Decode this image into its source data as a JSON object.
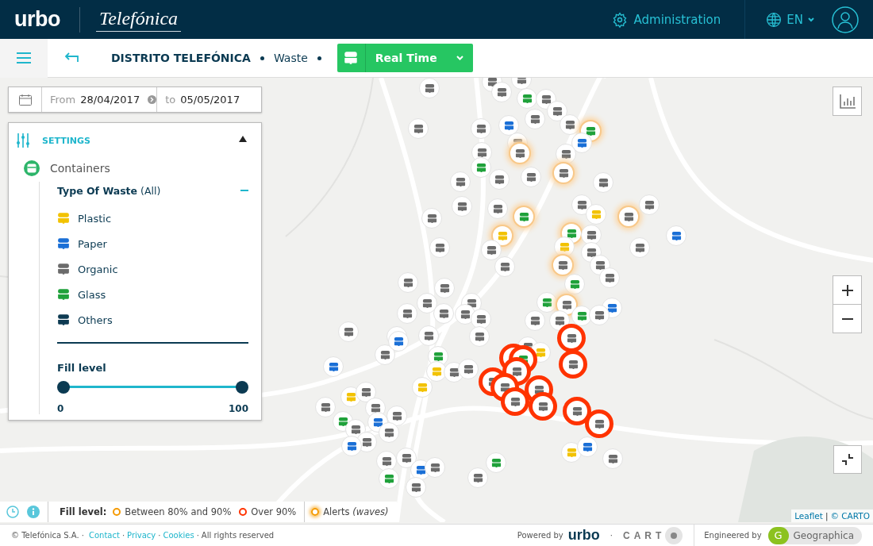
{
  "header": {
    "logo": "urbo",
    "partner_logo": "Telefónica",
    "admin": "Administration",
    "language": "EN"
  },
  "toolbar": {
    "breadcrumb": [
      {
        "label": "DISTRITO TELEFÓNICA",
        "kind": "strong"
      },
      {
        "label": "Waste",
        "kind": "plain"
      }
    ],
    "mode": "Real Time"
  },
  "date_range": {
    "from_label": "From",
    "from": "28/04/2017",
    "to_label": "to",
    "to": "05/05/2017"
  },
  "settings": {
    "title": "SETTINGS",
    "expanded": true,
    "layer": "Containers",
    "filter_title": "**Type Of Waste** (All)",
    "types": [
      {
        "label": "Plastic",
        "color": "#f2c200"
      },
      {
        "label": "Paper",
        "color": "#1a6fd6"
      },
      {
        "label": "Organic",
        "color": "#6b6b6b"
      },
      {
        "label": "Glass",
        "color": "#1fa13a"
      },
      {
        "label": "Others",
        "color": "#0d3a52"
      }
    ],
    "fill_level": {
      "title": "Fill level",
      "thumbs": [
        {
          "level": 0,
          "label": "0"
        },
        {
          "level": 1,
          "label": "100"
        }
      ]
    }
  },
  "legend": {
    "title": "Fill level:",
    "items": [
      {
        "label": "Between 80% and 90%",
        "kind": "ring",
        "color": "#f59a00"
      },
      {
        "label": "Over 90%",
        "kind": "ring",
        "color": "#ff3300"
      },
      {
        "label": "Alerts *(waves)*",
        "kind": "wave",
        "color": "#f59a00"
      }
    ]
  },
  "attribution": {
    "leaflet": "Leaflet",
    "separator": "|",
    "carto": "© CARTO"
  },
  "footer": {
    "copyright": "© Telefónica S.A. ·",
    "links": [
      "Contact",
      "Privacy",
      "Cookies"
    ],
    "separators": [
      "·",
      "·",
      "·"
    ],
    "powered_separator": "·",
    "rights": "All rights reserved",
    "powered_by": "Powered by",
    "powered_logo": "urbo",
    "carto_logo": "CART",
    "engineered_by": "Engineered by",
    "geo_letter": "G",
    "geo_name": "Geographica"
  }
}
